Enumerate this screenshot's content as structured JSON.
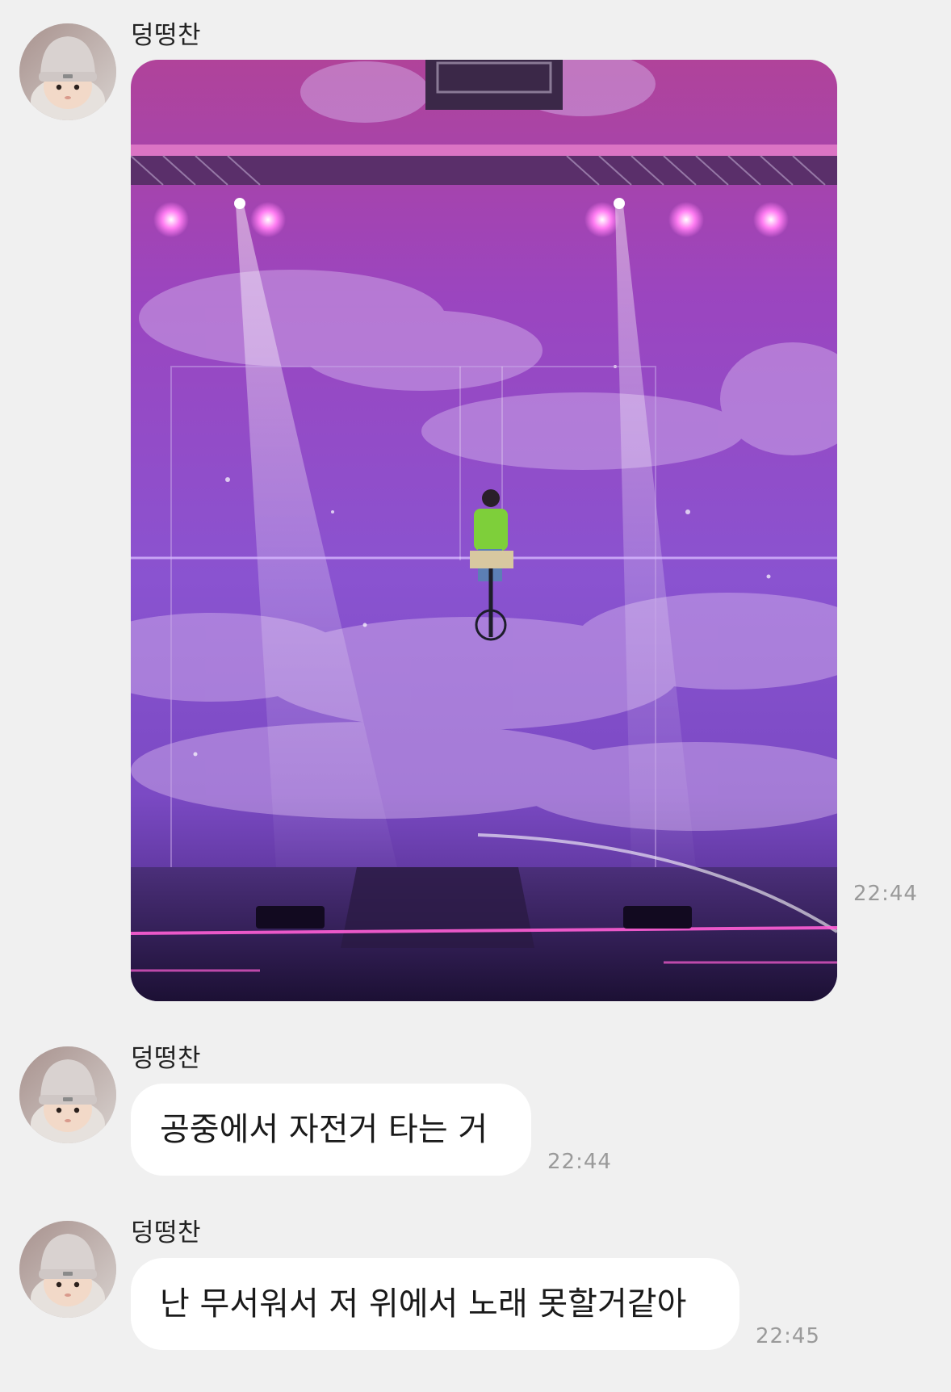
{
  "messages": [
    {
      "sender": "덩떵찬",
      "type": "image",
      "image_alt": "concert stage photo",
      "time": "22:44"
    },
    {
      "sender": "덩떵찬",
      "type": "text",
      "text": "공중에서 자전거 타는 거",
      "time": "22:44"
    },
    {
      "sender": "덩떵찬",
      "type": "text",
      "text": "난 무서워서 저 위에서 노래 못할거같아",
      "time": "22:45"
    }
  ],
  "colors": {
    "background": "#f0f0f0",
    "bubble": "#ffffff",
    "timestamp": "#9a9a9a",
    "stage_purple": "#8a4fc9",
    "stage_magenta": "#c24fb0",
    "jacket_green": "#7ecf3a"
  }
}
